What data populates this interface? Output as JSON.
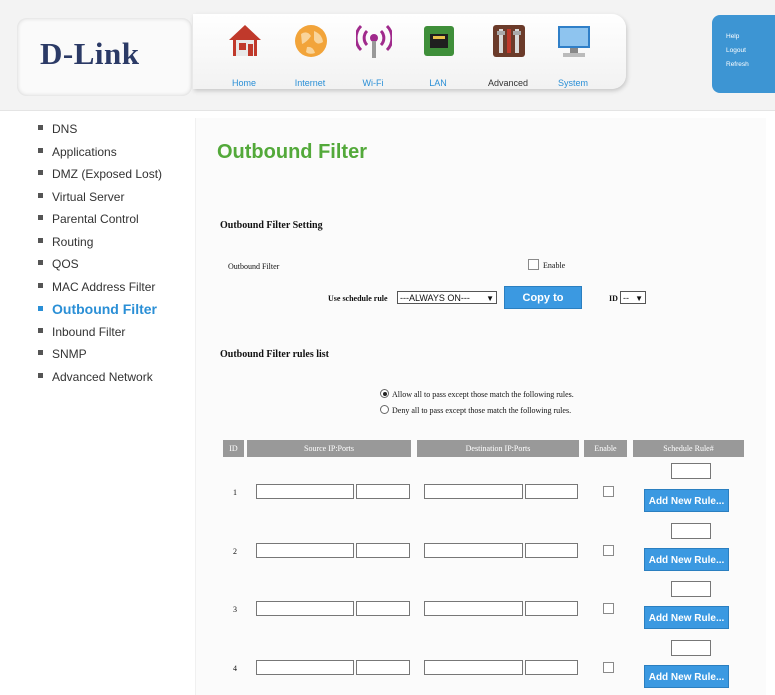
{
  "brand": {
    "logo": "D-Link"
  },
  "nav": [
    {
      "label": "Home",
      "icon": "home-icon"
    },
    {
      "label": "Internet",
      "icon": "globe-icon"
    },
    {
      "label": "Wi-Fi",
      "icon": "wifi-icon"
    },
    {
      "label": "LAN",
      "icon": "lan-icon"
    },
    {
      "label": "Advanced",
      "icon": "tools-icon"
    },
    {
      "label": "System",
      "icon": "monitor-icon"
    }
  ],
  "side_links": {
    "help": "Help",
    "logout": "Logout",
    "refresh": "Refresh"
  },
  "sidebar": {
    "items": [
      {
        "label": "DNS"
      },
      {
        "label": "Applications"
      },
      {
        "label": "DMZ (Exposed Lost)"
      },
      {
        "label": "Virtual Server"
      },
      {
        "label": "Parental Control"
      },
      {
        "label": "Routing"
      },
      {
        "label": "QOS"
      },
      {
        "label": "MAC Address Filter"
      },
      {
        "label": "Outbound Filter"
      },
      {
        "label": "Inbound Filter"
      },
      {
        "label": "SNMP"
      },
      {
        "label": "Advanced Network"
      }
    ]
  },
  "page": {
    "title": "Outbound Filter",
    "setting_heading": "Outbound Filter Setting",
    "filter_label": "Outbound Filter",
    "enable_label": "Enable",
    "schedule_label": "Use schedule rule",
    "schedule_value": "---ALWAYS ON---",
    "copy_button": "Copy to",
    "id_label": "ID",
    "id_value": "--",
    "rules_heading": "Outbound Filter rules list",
    "radio_allow": "Allow all to pass except those match the following rules.",
    "radio_deny": "Deny all to pass except those match the following rules."
  },
  "table": {
    "headers": [
      "ID",
      "Source IP:Ports",
      "Destination IP:Ports",
      "Enable",
      "Schedule Rule#"
    ],
    "rows": [
      {
        "id": "1",
        "add_label": "Add New Rule..."
      },
      {
        "id": "2",
        "add_label": "Add New Rule..."
      },
      {
        "id": "3",
        "add_label": "Add New Rule..."
      },
      {
        "id": "4",
        "add_label": "Add New Rule..."
      }
    ]
  },
  "colors": {
    "accent_blue": "#3b99e1",
    "title_green": "#53a93a",
    "header_gray": "#999999"
  }
}
